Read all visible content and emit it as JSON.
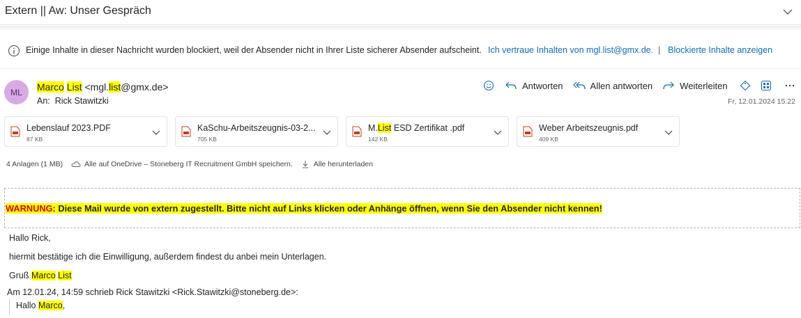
{
  "subject": "Extern || Aw: Unser Gespräch",
  "info_bar": {
    "text": "Einige Inhalte in dieser Nachricht wurden blockiert, weil der Absender nicht in Ihrer Liste sicherer Absender aufscheint.",
    "trust_link": "Ich vertraue Inhalten von mgl.list@gmx.de.",
    "separator": "|",
    "show_blocked_link": "Blockierte Inhalte anzeigen"
  },
  "sender": {
    "initials": "ML",
    "first_name": "Marco",
    "last_name": "List",
    "email_prefix": "<mgl.",
    "email_highlight": "list",
    "email_suffix": "@gmx.de>",
    "to_label": "An:",
    "to_name": "Rick Stawitzki",
    "date": "Fr, 12.01.2024 15:22"
  },
  "actions": {
    "reply": "Antworten",
    "reply_all": "Allen antworten",
    "forward": "Weiterleiten"
  },
  "attachments": [
    {
      "name_before": "Lebenslauf 2023.PDF",
      "name_highlight": "",
      "name_after": "",
      "size": "87 KB"
    },
    {
      "name_before": "KaSchu-Arbeitszeugnis-03-2...",
      "name_highlight": "",
      "name_after": "",
      "size": "705 KB"
    },
    {
      "name_before": "M.",
      "name_highlight": "List",
      "name_after": " ESD Zertifikat .pdf",
      "size": "142 KB"
    },
    {
      "name_before": "Weber Arbeitszeugnis.pdf",
      "name_highlight": "",
      "name_after": "",
      "size": "409 KB"
    }
  ],
  "attachment_summary": {
    "count": "4 Anlagen (1 MB)",
    "save_onedrive": "Alle auf OneDrive – Stoneberg IT Recruitment GmbH speichern.",
    "download_all": "Alle herunterladen"
  },
  "warning": {
    "label": "WARNUNG",
    "text": ": Diese Mail wurde von extern zugestellt. Bitte nicht auf Links klicken oder Anhänge öffnen, wenn Sie den Absender nicht kennen!"
  },
  "body": {
    "greeting": "Hallo Rick,",
    "line1": "hiermit bestätige ich die Einwilligung, außerdem findest du anbei mein Unterlagen.",
    "closing_prefix": "Gruß ",
    "closing_first": "Marco",
    "closing_last": "List",
    "quote_header": "Am 12.01.24, 14:59 schrieb Rick Stawitzki <Rick.Stawitzki@stoneberg.de>:",
    "quote_greeting_prefix": "Hallo ",
    "quote_greeting_name": "Marco",
    "quote_greeting_suffix": ","
  },
  "colors": {
    "accent": "#0f6cbd",
    "highlight": "#ffff00",
    "warning_red": "#e00000",
    "avatar_bg": "#d9a9e6"
  }
}
